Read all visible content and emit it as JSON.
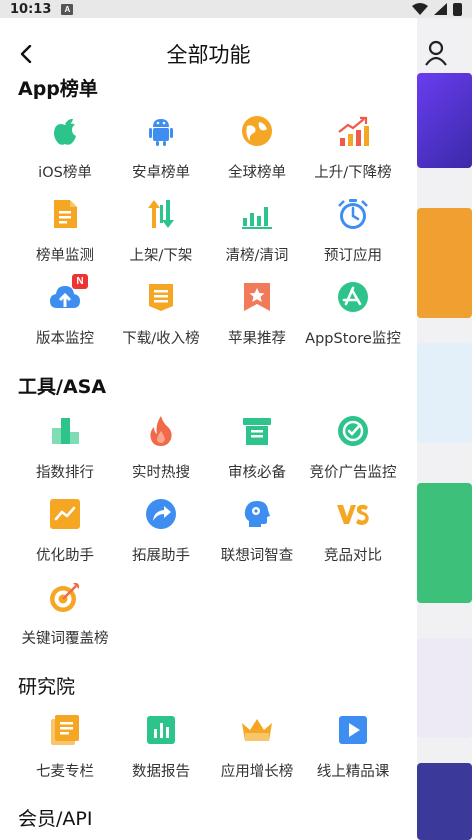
{
  "status_bar": {
    "time": "10:13",
    "notification_letter": "A"
  },
  "header": {
    "title": "全部功能"
  },
  "sections": [
    {
      "title": "App榜单",
      "items": [
        {
          "label": "iOS榜单",
          "icon": "apple-icon"
        },
        {
          "label": "安卓榜单",
          "icon": "android-icon"
        },
        {
          "label": "全球榜单",
          "icon": "globe-icon"
        },
        {
          "label": "上升/下降榜",
          "icon": "trend-up-icon"
        },
        {
          "label": "榜单监测",
          "icon": "document-icon"
        },
        {
          "label": "上架/下架",
          "icon": "up-down-arrows-icon"
        },
        {
          "label": "清榜/清词",
          "icon": "bar-chart-icon"
        },
        {
          "label": "预订应用",
          "icon": "stopwatch-icon"
        },
        {
          "label": "版本监控",
          "icon": "cloud-upload-icon",
          "badge": "N"
        },
        {
          "label": "下载/收入榜",
          "icon": "download-list-icon"
        },
        {
          "label": "苹果推荐",
          "icon": "star-bookmark-icon"
        },
        {
          "label": "AppStore监控",
          "icon": "appstore-icon"
        }
      ]
    },
    {
      "title": "工具/ASA",
      "items": [
        {
          "label": "指数排行",
          "icon": "index-bars-icon"
        },
        {
          "label": "实时热搜",
          "icon": "flame-icon"
        },
        {
          "label": "审核必备",
          "icon": "archive-box-icon"
        },
        {
          "label": "竞价广告监控",
          "icon": "target-check-icon"
        },
        {
          "label": "优化助手",
          "icon": "line-chart-icon"
        },
        {
          "label": "拓展助手",
          "icon": "share-arrow-icon"
        },
        {
          "label": "联想词智查",
          "icon": "head-gear-icon"
        },
        {
          "label": "竞品对比",
          "icon": "vs-icon"
        },
        {
          "label": "关键词覆盖榜",
          "icon": "dart-target-icon"
        }
      ]
    },
    {
      "title": "研究院",
      "items": [
        {
          "label": "七麦专栏",
          "icon": "column-doc-icon"
        },
        {
          "label": "数据报告",
          "icon": "report-chart-icon"
        },
        {
          "label": "应用增长榜",
          "icon": "crown-icon"
        },
        {
          "label": "线上精品课",
          "icon": "play-video-icon"
        }
      ]
    },
    {
      "title": "会员/API",
      "items": []
    }
  ],
  "colors": {
    "green": "#2cc48a",
    "blue": "#3d8ef0",
    "orange": "#f5a623",
    "red": "#f05a4a"
  }
}
